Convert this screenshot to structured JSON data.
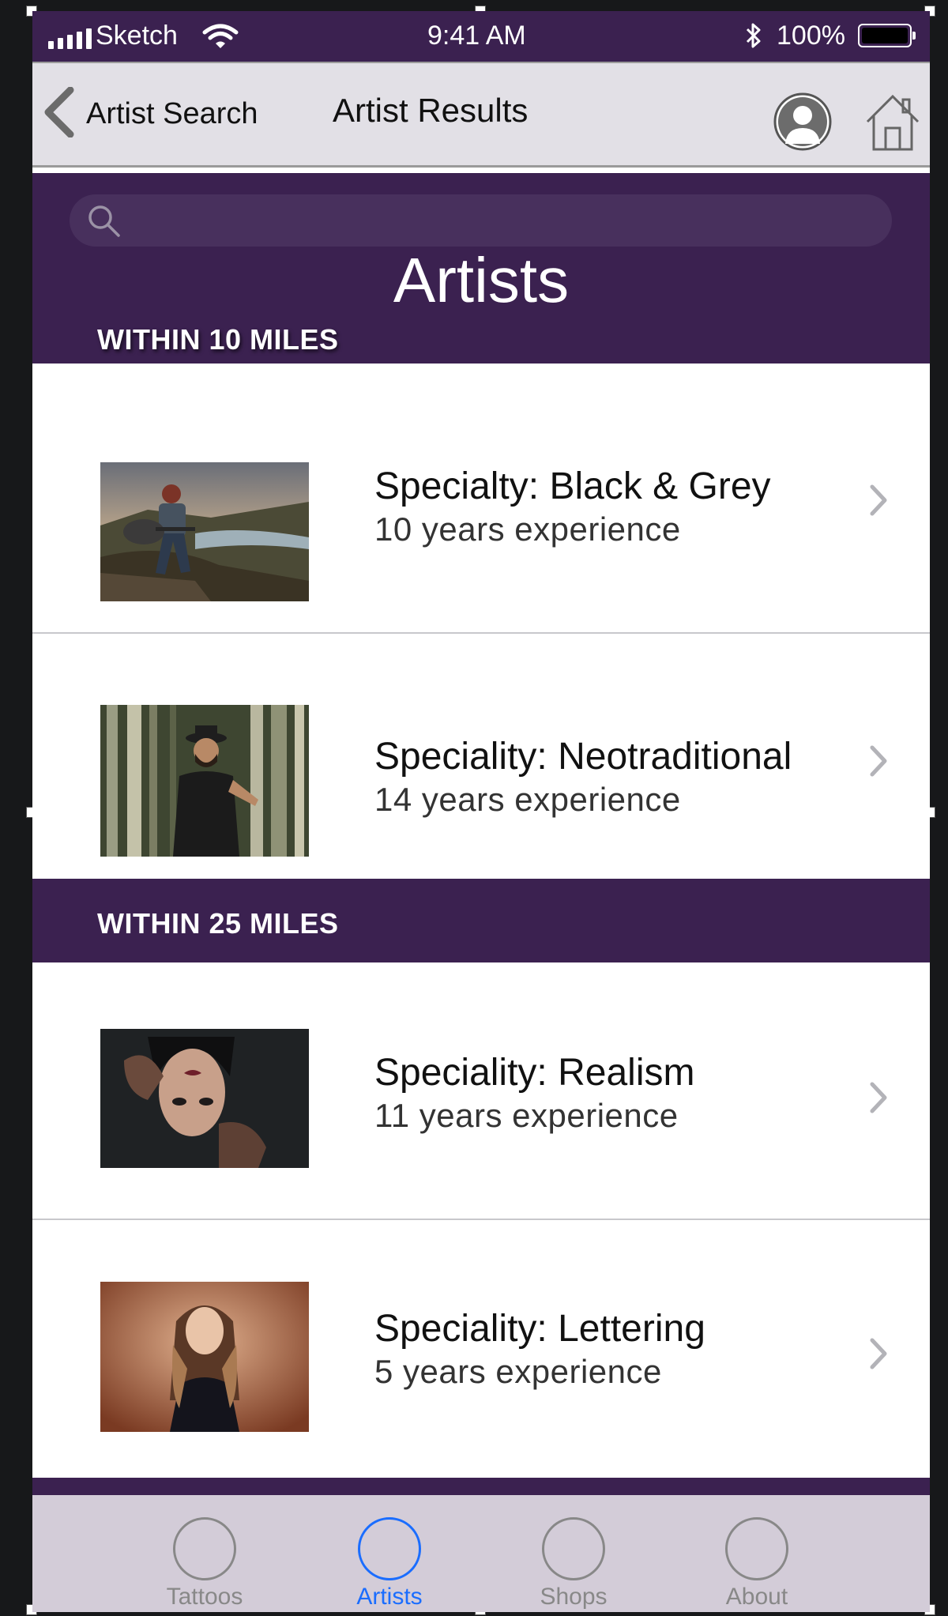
{
  "status_bar": {
    "carrier": "Sketch",
    "time": "9:41 AM",
    "battery": "100%"
  },
  "nav": {
    "back_label": "Artist Search",
    "title": "Artist Results"
  },
  "search": {
    "placeholder": ""
  },
  "header": {
    "title": "Artists"
  },
  "sections": [
    {
      "label": "WITHIN 10 MILES",
      "artists": [
        {
          "title": "Specialty: Black & Grey",
          "subtitle": "10 years experience",
          "photo": "man-with-guitar-photo"
        },
        {
          "title": "Speciality: Neotraditional",
          "subtitle": "14 years experience",
          "photo": "man-in-bamboo-photo"
        }
      ]
    },
    {
      "label": "WITHIN 25 MILES",
      "artists": [
        {
          "title": "Speciality: Realism",
          "subtitle": "11 years experience",
          "photo": "woman-upside-down-photo"
        },
        {
          "title": "Speciality: Lettering",
          "subtitle": "5 years experience",
          "photo": "woman-long-hair-photo"
        }
      ]
    }
  ],
  "tabs": [
    {
      "label": "Tattoos",
      "active": false
    },
    {
      "label": "Artists",
      "active": true
    },
    {
      "label": "Shops",
      "active": false
    },
    {
      "label": "About",
      "active": false
    }
  ],
  "colors": {
    "brand_purple": "#3b2150",
    "tab_active": "#1a6dff",
    "tab_inactive": "#888888"
  }
}
